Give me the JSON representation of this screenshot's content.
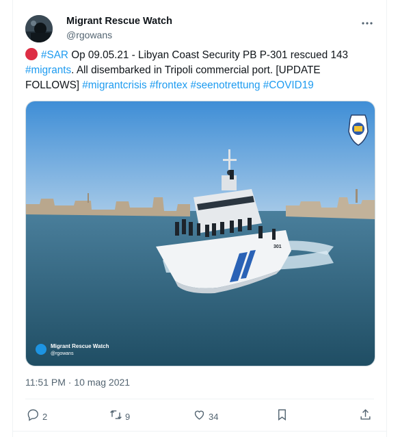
{
  "tweet": {
    "author_name": "Migrant Rescue Watch",
    "author_handle": "@rgowans",
    "text": {
      "part1": "Op 09.05.21 - Libyan Coast Security PB P-301 rescued 143 ",
      "part2": ". All disembarked in Tripoli commercial port. [UPDATE FOLLOWS] ",
      "sep": " "
    },
    "hashtags": {
      "sar": "#SAR",
      "migrants": "#migrants",
      "migrantcrisis": "#migrantcrisis",
      "frontex": "#frontex",
      "seenotrettung": "#seenotrettung",
      "covid19": "#COVID19"
    },
    "timestamp": "11:51 PM · 10 mag 2021",
    "media": {
      "watermark_name": "Migrant Rescue Watch",
      "watermark_handle": "@rgowans",
      "vessel_number": "301"
    }
  },
  "actions": {
    "replies": "2",
    "retweets": "9",
    "likes": "34"
  },
  "icons": {
    "more": "more-horizontal-icon",
    "reply": "reply-icon",
    "retweet": "retweet-icon",
    "like": "heart-icon",
    "bookmark": "bookmark-icon",
    "share": "share-icon",
    "status": "red-circle-icon"
  },
  "colors": {
    "link": "#1d9bf0",
    "text": "#0f1419",
    "muted": "#536471",
    "status_dot": "#dd2e44"
  }
}
